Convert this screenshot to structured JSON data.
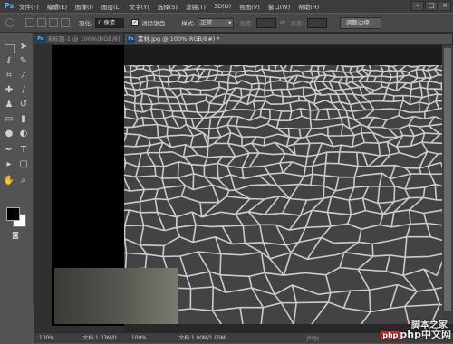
{
  "app": {
    "logo": "Ps"
  },
  "menu": [
    "文件(F)",
    "编辑(E)",
    "图像(I)",
    "图层(L)",
    "文字(Y)",
    "选择(S)",
    "滤镜(T)",
    "3D(D)",
    "视图(V)",
    "窗口(W)",
    "帮助(H)"
  ],
  "window_controls": {
    "minimize": "–",
    "maximize": "□",
    "close": "×"
  },
  "options": {
    "feather_label": "羽化:",
    "feather_value": "0 像素",
    "antialias_label": "消除锯齿",
    "style_label": "样式:",
    "style_value": "正常",
    "width_label": "宽度:",
    "height_label": "高度:",
    "refine_edge_button": "调整边缘..."
  },
  "tabs": [
    {
      "label": "未标题-1 @ 100%(RGB/8)",
      "active": false
    },
    {
      "label": "素材.jpg @ 100%(RGB/8#) *",
      "active": true
    }
  ],
  "status": {
    "doc1_zoom": "100%",
    "doc1_info": "文档:1.03M/0",
    "doc2_zoom": "100%",
    "doc2_info": "文档:1.00M/1.00M"
  },
  "watermark": {
    "text": "脚本之家",
    "site": "php中文网",
    "url_fragment": "jingy"
  },
  "colors": {
    "accent": "#5bb6f5",
    "foreground": "#000000",
    "background": "#ffffff"
  }
}
